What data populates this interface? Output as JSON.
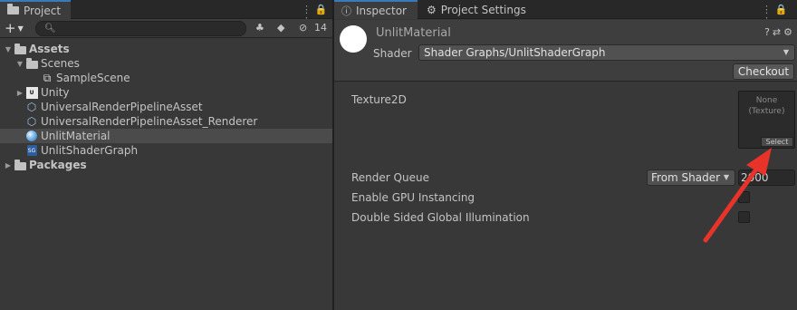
{
  "project": {
    "tab_label": "Project",
    "tab_controls": "⋮ 🔒 ⋮",
    "add_label": "+",
    "search_placeholder": "",
    "hidden_count": "14",
    "tree": [
      {
        "label": "Assets",
        "icon": "folder-open-icon",
        "expanded": true
      },
      {
        "label": "Scenes",
        "icon": "folder-open-icon",
        "expanded": true
      },
      {
        "label": "SampleScene",
        "icon": "scene-icon"
      },
      {
        "label": "Unity",
        "icon": "unity-package-icon",
        "expanded": false
      },
      {
        "label": "UniversalRenderPipelineAsset",
        "icon": "asset-cube-icon"
      },
      {
        "label": "UniversalRenderPipelineAsset_Renderer",
        "icon": "asset-cube-icon"
      },
      {
        "label": "UnlitMaterial",
        "icon": "material-icon",
        "selected": true
      },
      {
        "label": "UnlitShaderGraph",
        "icon": "shader-graph-icon"
      },
      {
        "label": "Packages",
        "icon": "folder-icon",
        "expanded": false
      }
    ]
  },
  "inspector": {
    "tab_label": "Inspector",
    "settings_tab_label": "Project Settings",
    "material_name": "UnlitMaterial",
    "shader_label": "Shader",
    "shader_value": "Shader Graphs/UnlitShaderGraph",
    "checkout_label": "Checkout",
    "texture_label": "Texture2D",
    "texture_none_line1": "None",
    "texture_none_line2": "(Texture)",
    "texture_select_label": "Select",
    "render_queue_label": "Render Queue",
    "render_queue_mode": "From Shader",
    "render_queue_value": "2000",
    "gpu_instancing_label": "Enable GPU Instancing",
    "double_sided_gi_label": "Double Sided Global Illumination"
  },
  "colors": {
    "background": "#383838",
    "tab_active_accent": "#3a79bb",
    "annotation_arrow": "#e8332a"
  }
}
